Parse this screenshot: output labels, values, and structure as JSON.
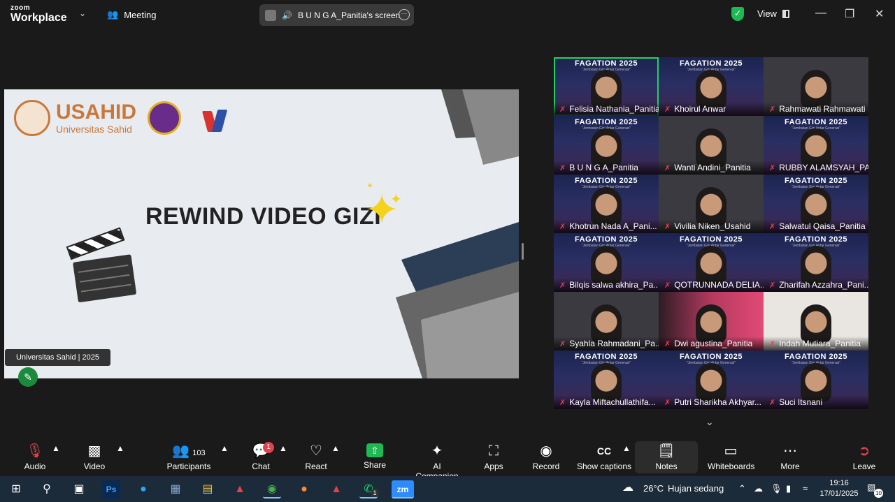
{
  "app": {
    "logo_top": "zoom",
    "logo_bottom": "Workplace",
    "meeting_label": "Meeting"
  },
  "screen_share": {
    "label": "B U N G A_Panitia's screen"
  },
  "view": {
    "label": "View"
  },
  "slide": {
    "brand_name": "USAHID",
    "brand_sub": "Universitas Sahid",
    "title": "REWIND VIDEO GIZI",
    "footer": "Universitas Sahid |  2025"
  },
  "gallery": {
    "event_title": "FAGATION 2025",
    "event_subtitle": "\"Jembatan Gizi Antar Generasi\"",
    "participants": [
      {
        "name": "Felisia Nathania_Panitia",
        "style": "event",
        "active": true
      },
      {
        "name": "Khoirul Anwar",
        "style": "event",
        "active": false
      },
      {
        "name": "Rahmawati Rahmawati",
        "style": "plain",
        "active": false
      },
      {
        "name": "B U N G A_Panitia",
        "style": "event",
        "active": false
      },
      {
        "name": "Wanti Andini_Panitia",
        "style": "plain",
        "active": false
      },
      {
        "name": "RUBBY ALAMSYAH_PA...",
        "style": "event",
        "active": false
      },
      {
        "name": "Khotrun Nada A_Pani...",
        "style": "event",
        "active": false
      },
      {
        "name": "Vivilia Niken_Usahid",
        "style": "plain",
        "active": false
      },
      {
        "name": "Salwatul Qaisa_Panitia",
        "style": "event",
        "active": false
      },
      {
        "name": "Bilqis salwa akhira_Pa...",
        "style": "event",
        "active": false
      },
      {
        "name": "QOTRUNNADA DELIA...",
        "style": "event",
        "active": false
      },
      {
        "name": "Zharifah Azzahra_Pani...",
        "style": "event",
        "active": false
      },
      {
        "name": "Syahla Rahmadani_Pa...",
        "style": "plain",
        "active": false
      },
      {
        "name": "Dwi agustina_Panitia",
        "style": "pink",
        "active": false
      },
      {
        "name": "Indah Mutiara_Panitia",
        "style": "light",
        "active": false
      },
      {
        "name": "Kayla Miftachullathifa...",
        "style": "event",
        "active": false
      },
      {
        "name": "Putri Sharikha Akhyar...",
        "style": "event",
        "active": false
      },
      {
        "name": "Suci Itsnani",
        "style": "event",
        "active": false
      }
    ]
  },
  "toolbar": {
    "audio": "Audio",
    "video": "Video",
    "participants": "Participants",
    "participants_count": "103",
    "chat": "Chat",
    "chat_badge": "1",
    "react": "React",
    "share": "Share",
    "ai_companion": "AI Companion",
    "apps": "Apps",
    "record": "Record",
    "captions": "Show captions",
    "notes": "Notes",
    "whiteboards": "Whiteboards",
    "more": "More",
    "leave": "Leave"
  },
  "taskbar": {
    "weather_temp": "26°C",
    "weather_text": "Hujan sedang",
    "time": "19:16",
    "date": "17/01/2025",
    "whatsapp_badge": "1",
    "notif_count": "10",
    "ps_label": "Ps",
    "zoom_label": "zm"
  }
}
